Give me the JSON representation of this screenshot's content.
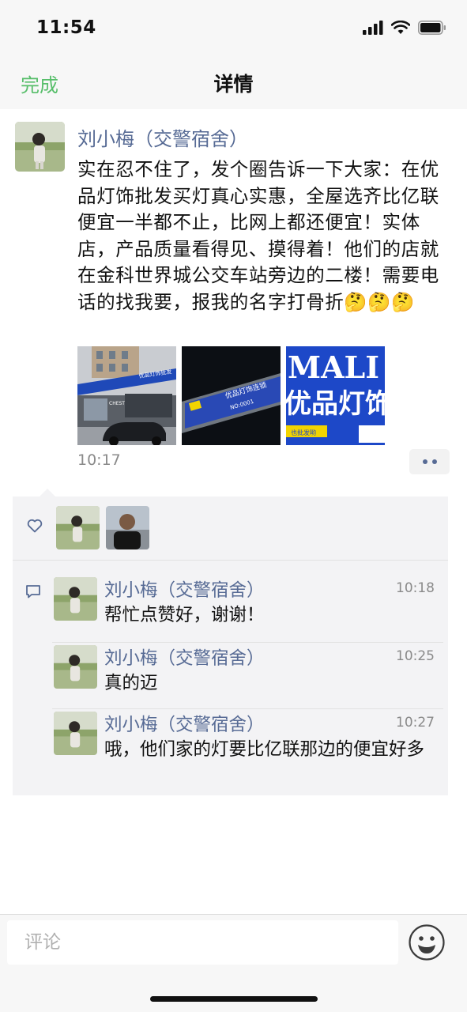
{
  "status_bar": {
    "time": "11:54",
    "icons": [
      "signal-icon",
      "wifi-icon",
      "battery-icon"
    ]
  },
  "nav": {
    "done_label": "完成",
    "title": "详情"
  },
  "post": {
    "author": "刘小梅（交警宿舍）",
    "text": "实在忍不住了，发个圈告诉一下大家：在优品灯饰批发买灯真心实惠，全屋选齐比亿联便宜一半都不止，比网上都还便宜！实体店，产品质量看得见、摸得着！他们的店就在金科世界城公交车站旁边的二楼！需要电话的找我要，报我的名字打骨折🤔🤔🤔",
    "time": "10:17",
    "photos": [
      {
        "name": "storefront-photo",
        "sign_text": "优品灯饰批发",
        "store_text": "CHEST"
      },
      {
        "name": "sign-closeup-photo",
        "sign_text": "优品灯饰连锁",
        "sub_text": "NO:0001"
      },
      {
        "name": "banner-photo",
        "top_text": "MALI",
        "main_text": "优品灯饰",
        "sub_text": "也批发哟"
      }
    ]
  },
  "likes": {
    "icon": "heart-outline-icon",
    "avatars": [
      "liker-1-avatar",
      "liker-2-avatar"
    ]
  },
  "comments": {
    "icon": "comment-bubble-icon",
    "items": [
      {
        "author": "刘小梅（交警宿舍）",
        "time": "10:18",
        "text": "帮忙点赞好，谢谢！"
      },
      {
        "author": "刘小梅（交警宿舍）",
        "time": "10:25",
        "text": "真的迈"
      },
      {
        "author": "刘小梅（交警宿舍）",
        "time": "10:27",
        "text": "哦，他们家的灯要比亿联那边的便宜好多"
      }
    ]
  },
  "input": {
    "placeholder": "评论",
    "emoji_icon": "smiley-face-icon"
  },
  "colors": {
    "accent_green": "#57be6a",
    "name_blue": "#576b95",
    "time_gray": "#8a8a8a",
    "panel_bg": "#f3f3f5"
  }
}
